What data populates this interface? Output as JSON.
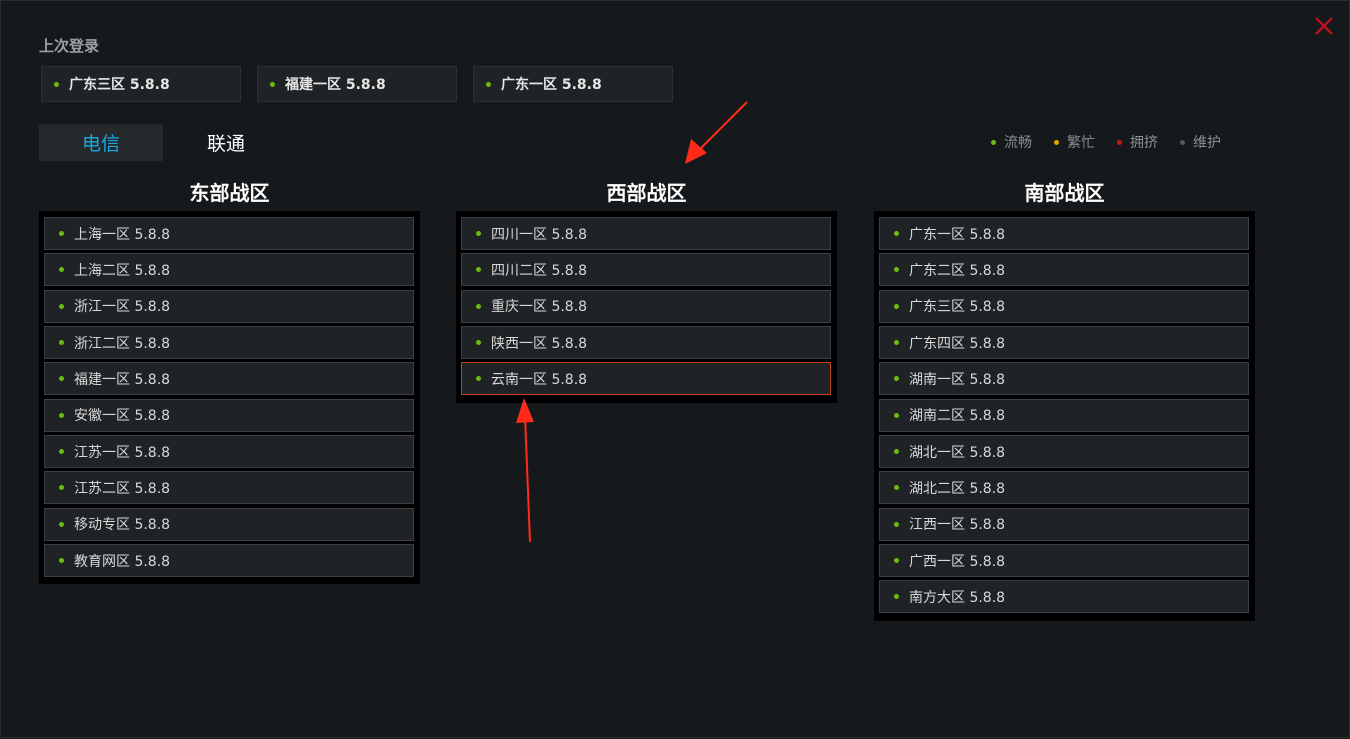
{
  "last_login": {
    "title": "上次登录",
    "servers": [
      {
        "label": "广东三区 5.8.8"
      },
      {
        "label": "福建一区 5.8.8"
      },
      {
        "label": "广东一区 5.8.8"
      }
    ]
  },
  "tabs": [
    {
      "label": "电信",
      "active": true
    },
    {
      "label": "联通",
      "active": false
    }
  ],
  "legend": [
    {
      "label": "流畅",
      "color": "#6dbb13"
    },
    {
      "label": "繁忙",
      "color": "#e0a800"
    },
    {
      "label": "拥挤",
      "color": "#d0101e"
    },
    {
      "label": "维护",
      "color": "#555a5f"
    }
  ],
  "regions": [
    {
      "title": "东部战区",
      "servers": [
        {
          "label": "上海一区 5.8.8"
        },
        {
          "label": "上海二区 5.8.8"
        },
        {
          "label": "浙江一区 5.8.8"
        },
        {
          "label": "浙江二区 5.8.8"
        },
        {
          "label": "福建一区 5.8.8"
        },
        {
          "label": "安徽一区 5.8.8"
        },
        {
          "label": "江苏一区 5.8.8"
        },
        {
          "label": "江苏二区 5.8.8"
        },
        {
          "label": "移动专区 5.8.8"
        },
        {
          "label": "教育网区 5.8.8"
        }
      ]
    },
    {
      "title": "西部战区",
      "servers": [
        {
          "label": "四川一区 5.8.8"
        },
        {
          "label": "四川二区 5.8.8"
        },
        {
          "label": "重庆一区 5.8.8"
        },
        {
          "label": "陕西一区 5.8.8"
        },
        {
          "label": "云南一区 5.8.8",
          "selected": true
        }
      ]
    },
    {
      "title": "南部战区",
      "servers": [
        {
          "label": "广东一区 5.8.8"
        },
        {
          "label": "广东二区 5.8.8"
        },
        {
          "label": "广东三区 5.8.8"
        },
        {
          "label": "广东四区 5.8.8"
        },
        {
          "label": "湖南一区 5.8.8"
        },
        {
          "label": "湖南二区 5.8.8"
        },
        {
          "label": "湖北一区 5.8.8"
        },
        {
          "label": "湖北二区 5.8.8"
        },
        {
          "label": "江西一区 5.8.8"
        },
        {
          "label": "广西一区 5.8.8"
        },
        {
          "label": "南方大区 5.8.8"
        }
      ]
    }
  ],
  "status_color": "#6dbb13",
  "accent_color": "#1aa7e0",
  "selected_border_color": "#c0421a",
  "close_icon_color": "#b8141c"
}
